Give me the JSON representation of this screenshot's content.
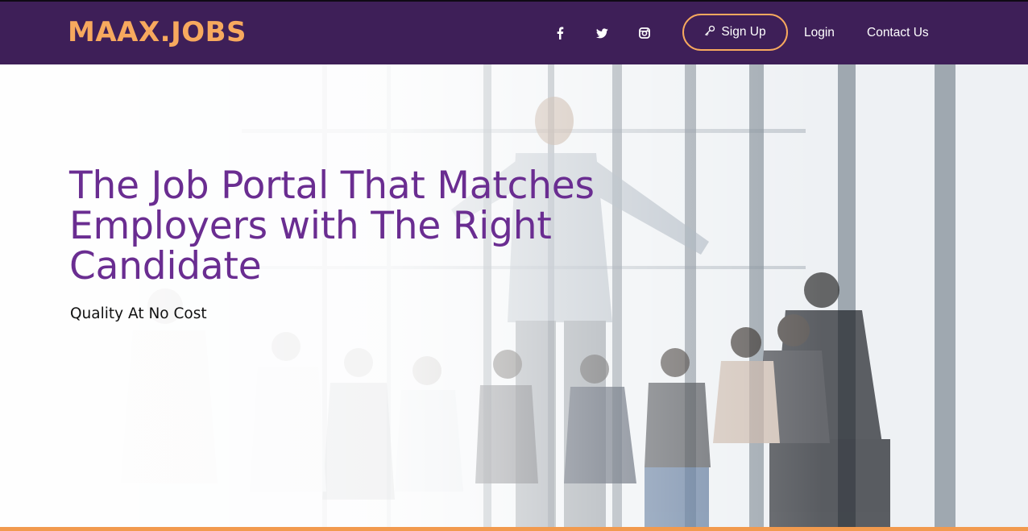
{
  "brand": {
    "logo_text": "MAAX.JOBS",
    "accent_color": "#f7a95e",
    "nav_bg_color": "#3e1f58"
  },
  "nav": {
    "social": [
      {
        "name": "facebook",
        "icon": "facebook-icon"
      },
      {
        "name": "twitter",
        "icon": "twitter-icon"
      },
      {
        "name": "instagram",
        "icon": "instagram-icon"
      }
    ],
    "signup_label": "Sign Up",
    "signup_icon": "key-icon",
    "login_label": "Login",
    "contact_label": "Contact Us"
  },
  "hero": {
    "headline": "The Job Portal That Matches Employers with The Right Candidate",
    "tagline": "Quality At No Cost",
    "headline_color": "#6a2d91",
    "image": "office-presentation-photo"
  },
  "footer_bar": {
    "color": "#f29a4e"
  }
}
